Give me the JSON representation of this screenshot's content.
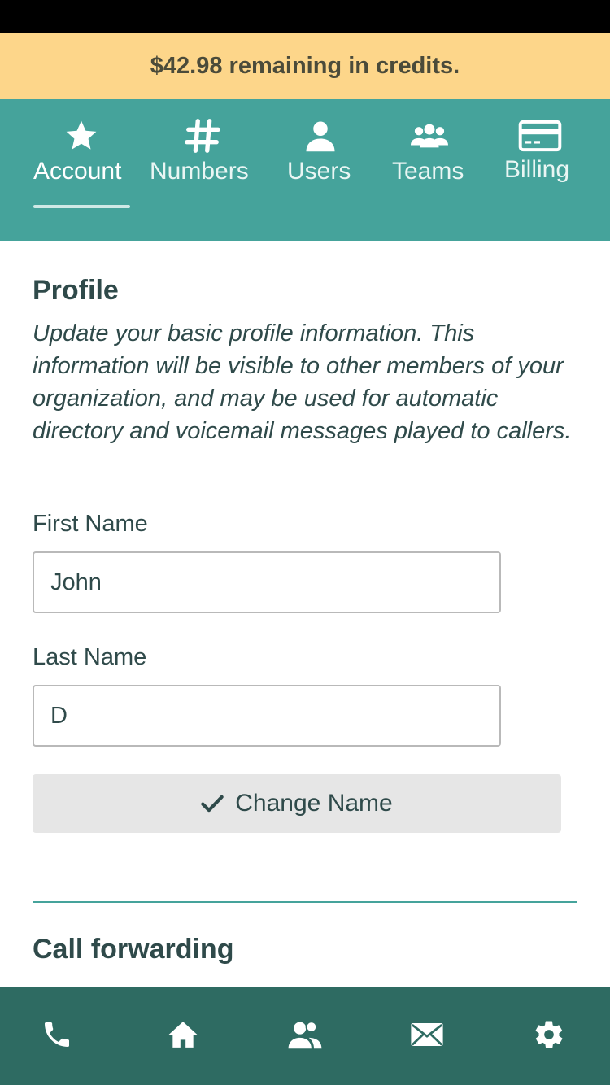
{
  "banner": {
    "credits_text": "$42.98 remaining in credits."
  },
  "top_nav": {
    "tabs": [
      {
        "label": "Account",
        "icon": "star-icon",
        "active": true
      },
      {
        "label": "Numbers",
        "icon": "hash-icon",
        "active": false
      },
      {
        "label": "Users",
        "icon": "user-icon",
        "active": false
      },
      {
        "label": "Teams",
        "icon": "team-icon",
        "active": false
      },
      {
        "label": "Billing",
        "icon": "credit-card-icon",
        "active": false
      }
    ]
  },
  "profile": {
    "title": "Profile",
    "description": "Update your basic profile information. This information will be visible to other members of your organization, and may be used for automatic directory and voicemail messages played to callers.",
    "first_name_label": "First Name",
    "first_name_value": "John",
    "last_name_label": "Last Name",
    "last_name_value": "D",
    "change_name_label": "Change Name"
  },
  "call_forwarding": {
    "title": "Call forwarding"
  },
  "bottom_nav": {
    "items": [
      "phone-icon",
      "home-icon",
      "contacts-icon",
      "mail-icon",
      "settings-icon"
    ]
  },
  "colors": {
    "banner": "#fdd68a",
    "nav": "#45a39b",
    "bottom_nav": "#2e6b62",
    "text": "#2f4a4a"
  }
}
